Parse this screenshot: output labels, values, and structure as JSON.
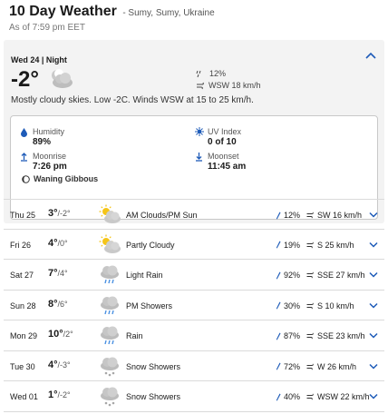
{
  "header": {
    "title": "10 Day Weather",
    "location": "- Sumy, Sumy, Ukraine",
    "as_of": "As of 7:59 pm EET"
  },
  "current": {
    "day_label": "Wed 24 | Night",
    "temp": "-2°",
    "precip": "12%",
    "wind": "WSW 18 km/h",
    "summary": "Mostly cloudy skies. Low -2C. Winds WSW at 15 to 25 km/h.",
    "icon": "moon-cloud-icon"
  },
  "details": {
    "humidity_label": "Humidity",
    "humidity_value": "89%",
    "uv_label": "UV Index",
    "uv_value": "0 of 10",
    "moonrise_label": "Moonrise",
    "moonrise_value": "7:26 pm",
    "moonset_label": "Moonset",
    "moonset_value": "11:45 am",
    "moon_phase": "Waning Gibbous"
  },
  "forecast": [
    {
      "day": "Thu 25",
      "hi": "3°",
      "lo": "/-2°",
      "icon": "sun-cloud-icon",
      "cond": "AM Clouds/PM Sun",
      "precip": "12%",
      "wind": "SW 16 km/h"
    },
    {
      "day": "Fri 26",
      "hi": "4°",
      "lo": "/0°",
      "icon": "sun-cloud-icon",
      "cond": "Partly Cloudy",
      "precip": "19%",
      "wind": "S 25 km/h"
    },
    {
      "day": "Sat 27",
      "hi": "7°",
      "lo": "/4°",
      "icon": "rain-icon",
      "cond": "Light Rain",
      "precip": "92%",
      "wind": "SSE 27 km/h"
    },
    {
      "day": "Sun 28",
      "hi": "8°",
      "lo": "/6°",
      "icon": "rain-icon",
      "cond": "PM Showers",
      "precip": "30%",
      "wind": "S 10 km/h"
    },
    {
      "day": "Mon 29",
      "hi": "10°",
      "lo": "/2°",
      "icon": "rain-icon",
      "cond": "Rain",
      "precip": "87%",
      "wind": "SSE 23 km/h"
    },
    {
      "day": "Tue 30",
      "hi": "4°",
      "lo": "/-3°",
      "icon": "snow-icon",
      "cond": "Snow Showers",
      "precip": "72%",
      "wind": "W 26 km/h"
    },
    {
      "day": "Wed 01",
      "hi": "1°",
      "lo": "/-2°",
      "icon": "snow-icon",
      "cond": "Snow Showers",
      "precip": "40%",
      "wind": "WSW 22 km/h"
    }
  ],
  "colors": {
    "accent": "#1e5bb8",
    "card_bg": "#f3f3f3",
    "divider": "#dadada"
  }
}
